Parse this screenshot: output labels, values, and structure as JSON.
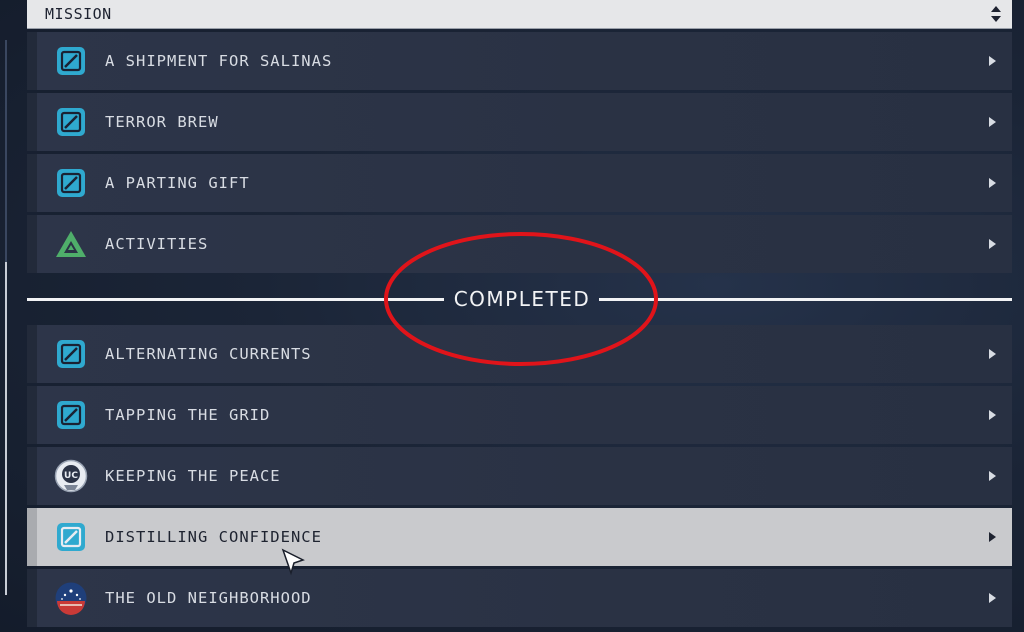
{
  "header": {
    "title": "MISSION",
    "sort_icon": "sort-updown-icon"
  },
  "active_missions": [
    {
      "label": "A SHIPMENT FOR SALINAS",
      "icon": "mission-blue-icon"
    },
    {
      "label": "TERROR BREW",
      "icon": "mission-blue-icon"
    },
    {
      "label": "A PARTING GIFT",
      "icon": "mission-blue-icon"
    },
    {
      "label": "ACTIVITIES",
      "icon": "activities-triangle-icon"
    }
  ],
  "completed_section": {
    "title": "COMPLETED"
  },
  "completed_missions": [
    {
      "label": "ALTERNATING CURRENTS",
      "icon": "mission-blue-icon"
    },
    {
      "label": "TAPPING THE GRID",
      "icon": "mission-blue-icon"
    },
    {
      "label": "KEEPING THE PEACE",
      "icon": "uc-faction-icon"
    },
    {
      "label": "DISTILLING CONFIDENCE",
      "icon": "mission-blue-icon",
      "selected": true
    },
    {
      "label": "THE OLD NEIGHBORHOOD",
      "icon": "constellation-icon"
    }
  ],
  "colors": {
    "mission_icon": "#2fa9cf",
    "activities_icon": "#4fae6a",
    "annotation_circle": "#e0141a",
    "selected_row": "#c9cacd"
  }
}
